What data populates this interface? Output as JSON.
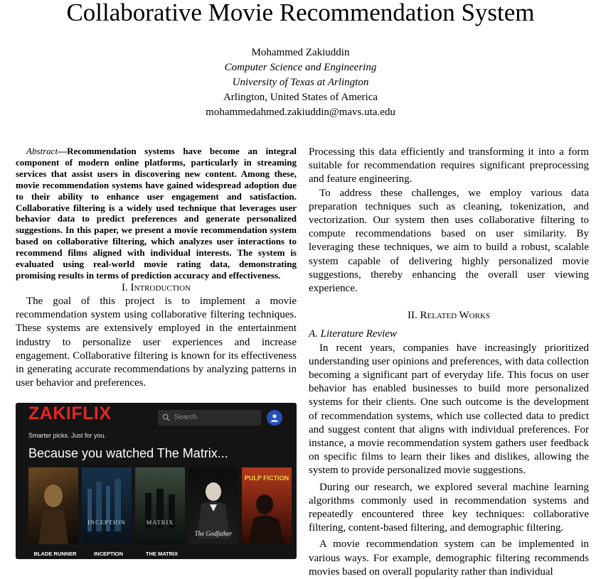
{
  "paper": {
    "title": "Collaborative Movie Recommendation System",
    "author": "Mohammed Zakiuddin",
    "department": "Computer Science and Engineering",
    "university": "University of Texas at Arlington",
    "location": "Arlington, United States of America",
    "email": "mohammedahmed.zakiuddin@mavs.uta.edu"
  },
  "abstract": {
    "label": "Abstract",
    "text": "Recommendation systems have become an integral component of modern online platforms, particularly in streaming services that assist users in discovering new content. Among these, movie recommendation systems have gained widespread adoption due to their ability to enhance user engagement and satisfaction. Collaborative filtering is a widely used technique that leverages user behavior data to predict preferences and generate personalized suggestions. In this paper, we present a movie recommendation system based on collaborative filtering, which analyzes user interactions to recommend films aligned with individual interests. The system is evaluated using real-world movie rating data, demonstrating promising results in terms of prediction accuracy and effectiveness."
  },
  "sections": {
    "intro_heading": "I. Introduction",
    "intro_p1": "The goal of this project is to implement a movie recommendation system using collaborative filtering techniques. These systems are extensively employed in the entertainment industry to personalize user experiences and increase engagement. Collaborative filtering is known for its effectiveness in generating accurate recommendations by analyzing patterns in user behavior and preferences.",
    "right_p1": "Processing this data efficiently and transforming it into a form suitable for recommendation requires significant preprocessing and feature engineering.",
    "right_p2": "To address these challenges, we employ various data preparation techniques such as cleaning, tokenization, and vectorization. Our system then uses collaborative filtering to compute recommendations based on user similarity. By leveraging these techniques, we aim to build a robust, scalable system capable of delivering highly personalized movie suggestions, thereby enhancing the overall user viewing experience.",
    "related_heading": "II. Related Works",
    "lit_heading": "A. Literature Review",
    "lit_p1": "In recent years, companies have increasingly prioritized understanding user opinions and preferences, with data collection becoming a significant part of everyday life. This focus on user behavior has enabled businesses to build more personalized systems for their clients. One such outcome is the development of recommendation systems, which use collected data to predict and suggest content that aligns with individual preferences. For instance, a movie recommendation system gathers user feedback on specific films to learn their likes and dislikes, allowing the system to provide personalized movie suggestions.",
    "lit_p2": "During our research, we explored several machine learning algorithms commonly used in recommendation systems and repeatedly encountered three key techniques: collaborative filtering, content-based filtering, and demographic filtering.",
    "lit_p3": "A movie recommendation system can be implemented in various ways. For example, demographic filtering recommends movies based on overall popularity rather than individual"
  },
  "figure": {
    "logo": "ZAKIFLIX",
    "tagline": "Smarter picks. Just for you.",
    "search_placeholder": "Search",
    "row_title": "Because you watched The Matrix...",
    "posters": [
      {
        "label": "BLADE RUNNER",
        "art_text": ""
      },
      {
        "label": "INCEPTION",
        "art_text": "INCEPTION"
      },
      {
        "label": "THE MATRIX",
        "art_text": "MATRIX"
      },
      {
        "label": "",
        "art_text": "The Godfather"
      },
      {
        "label": "",
        "art_text": "PULP FICTION"
      }
    ],
    "colors": {
      "logo": "#e32626",
      "background": "#141414",
      "avatar": "#2650b8"
    },
    "icons": [
      "search-icon",
      "user-avatar-icon"
    ]
  }
}
